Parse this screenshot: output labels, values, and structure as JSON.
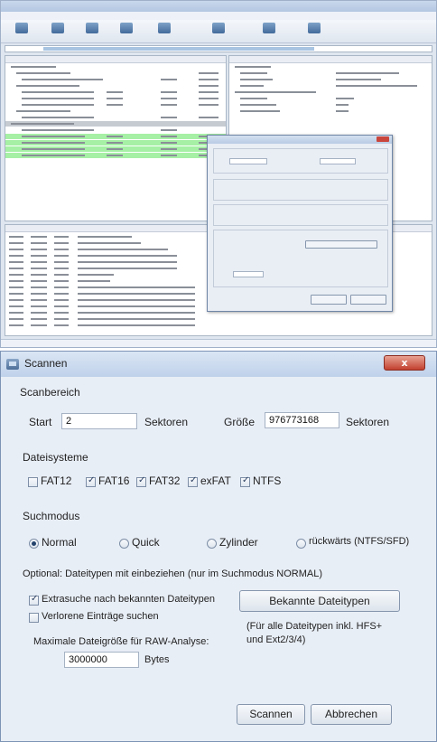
{
  "dialog": {
    "title": "Scannen",
    "close_label": "x",
    "scan_range": {
      "heading": "Scanbereich",
      "start_label": "Start",
      "start_value": "2",
      "start_unit": "Sektoren",
      "size_label": "Größe",
      "size_value": "976773168",
      "size_unit": "Sektoren"
    },
    "filesystems": {
      "heading": "Dateisysteme",
      "items": [
        {
          "label": "FAT12",
          "checked": false
        },
        {
          "label": "FAT16",
          "checked": true
        },
        {
          "label": "FAT32",
          "checked": true
        },
        {
          "label": "exFAT",
          "checked": true
        },
        {
          "label": "NTFS",
          "checked": true
        }
      ]
    },
    "search_mode": {
      "heading": "Suchmodus",
      "options": [
        {
          "label": "Normal",
          "selected": true
        },
        {
          "label": "Quick",
          "selected": false
        },
        {
          "label": "Zylinder",
          "selected": false
        },
        {
          "label": "rückwärts (NTFS/SFD)",
          "selected": false
        }
      ]
    },
    "optional": {
      "heading": "Optional: Dateitypen mit einbeziehen (nur im Suchmodus NORMAL)",
      "extra_search_label": "Extrasuche nach bekannten Dateitypen",
      "extra_search_checked": true,
      "lost_entries_label": "Verlorene Einträge suchen",
      "lost_entries_checked": false,
      "known_types_button": "Bekannte Dateitypen",
      "note": "(Für alle Dateitypen inkl. HFS+ und Ext2/3/4)",
      "max_size_label": "Maximale Dateigröße für RAW-Analyse:",
      "max_size_value": "3000000",
      "max_size_unit": "Bytes"
    },
    "buttons": {
      "scan": "Scannen",
      "cancel": "Abbrechen"
    }
  },
  "colors": {
    "selected_row": "#c6cbd2",
    "highlight_rows": "#a6f0a6",
    "close_button": "#c2402f"
  },
  "icons": [
    "app-icon",
    "close-icon",
    "toolbar-icon"
  ]
}
